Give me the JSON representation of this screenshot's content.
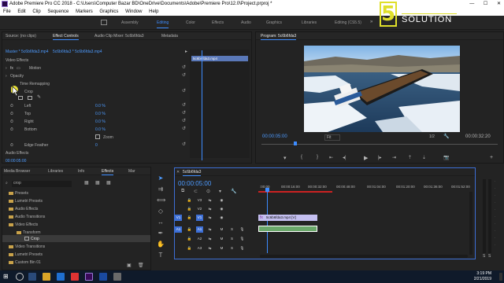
{
  "window": {
    "title": "Adobe Premiere Pro CC 2018 - C:\\Users\\Computer Bazar BD\\OneDrive\\Documents\\Adobe\\Premiere Pro\\12.0\\Project.prproj *"
  },
  "menu": [
    "File",
    "Edit",
    "Clip",
    "Sequence",
    "Markers",
    "Graphics",
    "Window",
    "Help"
  ],
  "workspaces": {
    "items": [
      "Assembly",
      "Editing",
      "Color",
      "Effects",
      "Audio",
      "Graphics",
      "Libraries",
      "Editing (CS5.5)"
    ],
    "active": "Editing"
  },
  "logo": {
    "number": "5",
    "line1": "MINUTE",
    "line2": "SOLUTION"
  },
  "source_panel": {
    "tabs": [
      "Source: (no clips)",
      "Effect Controls",
      "Audio Clip Mixer: 5c6b6fda3",
      "Metadata"
    ],
    "active": "Effect Controls",
    "master_label": "Master * 5c6b6fda3.mp4",
    "clip_label": "5c6b6fda3 * 5c6b6fda3.mp4",
    "clip_bar": "5c6b6fda3.mp4",
    "video_effects": "Video Effects",
    "motion": "Motion",
    "opacity": "Opacity",
    "time_remapping": "Time Remapping",
    "crop": "Crop",
    "params": [
      {
        "label": "Left",
        "value": "0.0 %"
      },
      {
        "label": "Top",
        "value": "0.0 %"
      },
      {
        "label": "Right",
        "value": "0.0 %"
      },
      {
        "label": "Bottom",
        "value": "0.0 %"
      }
    ],
    "zoom": "Zoom",
    "edge_feather": "Edge Feather",
    "edge_value": "0",
    "audio_effects": "Audio Effects",
    "timecode": "00:00:05:00"
  },
  "program": {
    "title": "Program: 5c6b6fda3",
    "timecode": "00:00:05:00",
    "fit": "Fit",
    "fraction": "1/2",
    "duration": "00:00:32:20"
  },
  "effects_panel": {
    "tabs": [
      "Media Browser",
      "Libraries",
      "Info",
      "Effects",
      "Mar"
    ],
    "active": "Effects",
    "search_value": "crop",
    "items": [
      {
        "label": "Presets",
        "depth": 0
      },
      {
        "label": "Lumetri Presets",
        "depth": 0
      },
      {
        "label": "Audio Effects",
        "depth": 0
      },
      {
        "label": "Audio Transitions",
        "depth": 0
      },
      {
        "label": "Video Effects",
        "depth": 0
      },
      {
        "label": "Transform",
        "depth": 1
      },
      {
        "label": "Crop",
        "depth": 2
      },
      {
        "label": "Video Transitions",
        "depth": 0
      },
      {
        "label": "Lumetri Presets",
        "depth": 0
      },
      {
        "label": "Custom Bin 01",
        "depth": 0
      }
    ]
  },
  "timeline": {
    "tab": "5c6b6fda3",
    "timecode": "00:00:05:00",
    "ruler": [
      ":00:00",
      "00:00:16:00",
      "00:00:32:00",
      "00:00:48:00",
      "00:01:04:00",
      "00:01:20:00",
      "00:01:36:00",
      "00:01:52:00"
    ],
    "tracks": [
      "V3",
      "V2",
      "V1",
      "A1",
      "A2",
      "A3"
    ],
    "source_tracks": [
      "V1",
      "A1"
    ],
    "video_clip": "5c6b6fda3.mp4 [V]",
    "mute": "M",
    "solo": "S"
  },
  "taskbar": {
    "time": "3:19 PM",
    "date": "2/21/2019"
  },
  "colors": {
    "accent": "#3d8cff",
    "logo_yellow": "#dfdf2a",
    "cursor_yellow": "#e8e03a",
    "video_clip": "#c4bff0",
    "audio_clip": "#6aa86a"
  }
}
